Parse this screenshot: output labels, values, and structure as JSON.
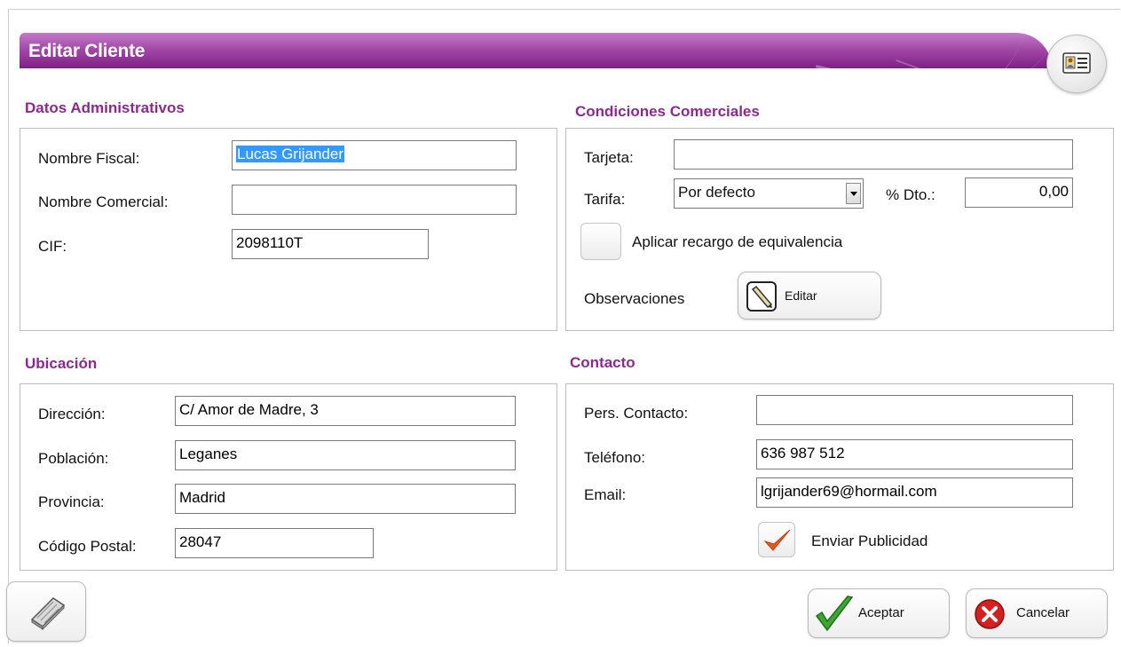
{
  "window": {
    "title": "Editar Cliente",
    "card_icon": "contact-card-icon"
  },
  "admin": {
    "title": "Datos Administrativos",
    "nombre_fiscal_label": "Nombre Fiscal:",
    "nombre_fiscal_value": "Lucas Grijander",
    "nombre_comercial_label": "Nombre Comercial:",
    "nombre_comercial_value": "",
    "cif_label": "CIF:",
    "cif_value": "2098110T"
  },
  "commercial": {
    "title": "Condiciones Comerciales",
    "tarjeta_label": "Tarjeta:",
    "tarjeta_value": "",
    "tarifa_label": "Tarifa:",
    "tarifa_value": "Por defecto",
    "dto_label": "% Dto.:",
    "dto_value": "0,00",
    "recargo_label": "Aplicar recargo de equivalencia",
    "recargo_checked": false,
    "observaciones_label": "Observaciones",
    "editar_label": "Editar"
  },
  "location": {
    "title": "Ubicación",
    "direccion_label": "Dirección:",
    "direccion_value": "C/ Amor de Madre, 3",
    "poblacion_label": "Población:",
    "poblacion_value": "Leganes",
    "provincia_label": "Provincia:",
    "provincia_value": "Madrid",
    "cp_label": "Código Postal:",
    "cp_value": "28047"
  },
  "contact": {
    "title": "Contacto",
    "persona_label": "Pers. Contacto:",
    "persona_value": "",
    "telefono_label": "Teléfono:",
    "telefono_value": "636 987 512",
    "email_label": "Email:",
    "email_value": "lgrijander69@hormail.com",
    "publicidad_label": "Enviar Publicidad",
    "publicidad_checked": true
  },
  "footer": {
    "keyboard_icon": "keyboard-icon",
    "aceptar_label": "Aceptar",
    "cancelar_label": "Cancelar"
  },
  "colors": {
    "accent": "#8a2a8f",
    "titlebar": "#a24aa8",
    "check": "#e8571f",
    "accept": "#3ea635",
    "cancel": "#d42020"
  }
}
